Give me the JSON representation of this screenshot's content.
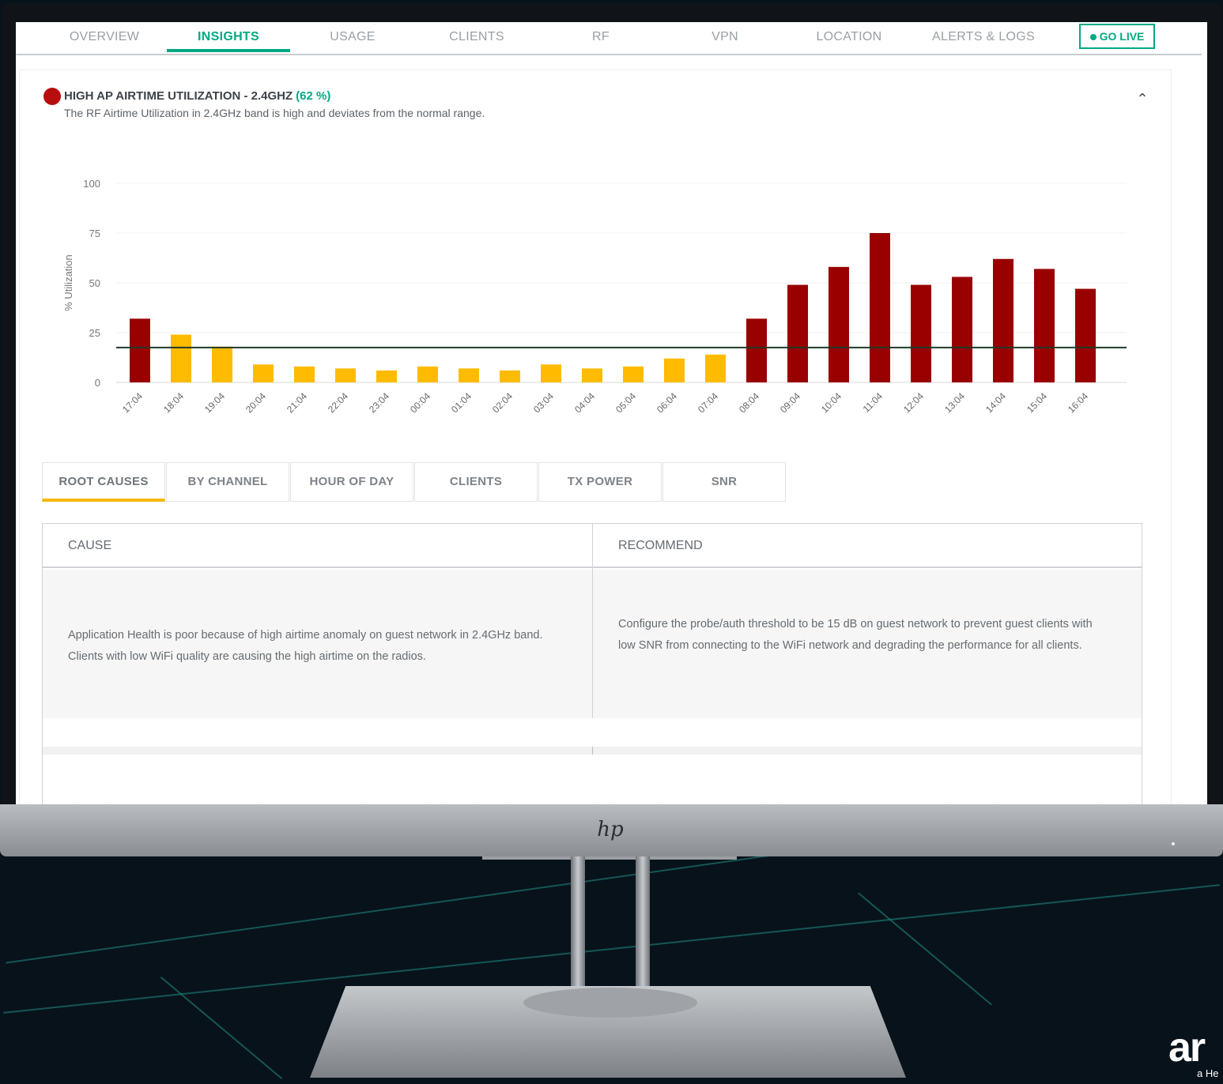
{
  "nav": {
    "tabs": [
      "OVERVIEW",
      "INSIGHTS",
      "USAGE",
      "CLIENTS",
      "RF",
      "VPN",
      "LOCATION",
      "ALERTS & LOGS"
    ],
    "active_tab": "INSIGHTS",
    "go_live": "GO LIVE"
  },
  "insight": {
    "title": "HIGH AP AIRTIME UTILIZATION - 2.4GHZ",
    "percent": "(62 %)",
    "description": "The RF Airtime Utilization in 2.4GHz band is high and deviates from the normal range.",
    "collapse_icon": "chevron-up-icon",
    "severity_color": "#b80d0d"
  },
  "chart_data": {
    "type": "bar",
    "ylabel": "% Utilization",
    "ylim": [
      0,
      100
    ],
    "yticks": [
      0,
      25,
      50,
      75,
      100
    ],
    "categories": [
      "17:04",
      "18:04",
      "19:04",
      "20:04",
      "21:04",
      "22:04",
      "23:04",
      "00:04",
      "01:04",
      "02:04",
      "03:04",
      "04:04",
      "05:04",
      "06:04",
      "07:04",
      "08:04",
      "09:04",
      "10:04",
      "11:04",
      "12:04",
      "13:04",
      "14:04",
      "15:04",
      "16:04"
    ],
    "values": [
      32,
      24,
      18,
      9,
      8,
      7,
      6,
      8,
      7,
      6,
      9,
      7,
      8,
      12,
      14,
      32,
      49,
      58,
      75,
      49,
      53,
      62,
      57,
      47
    ],
    "high_flags": [
      true,
      false,
      false,
      false,
      false,
      false,
      false,
      false,
      false,
      false,
      false,
      false,
      false,
      false,
      false,
      true,
      true,
      true,
      true,
      true,
      true,
      true,
      true,
      true
    ],
    "threshold": 17.5,
    "colors": {
      "high": "#990000",
      "normal": "#ffbb00",
      "threshold": "#1f3a2a",
      "grid": "#f0f0f0"
    },
    "grid": true
  },
  "subtabs": {
    "items": [
      "ROOT CAUSES",
      "BY CHANNEL",
      "HOUR OF DAY",
      "CLIENTS",
      "TX POWER",
      "SNR"
    ],
    "active": "ROOT CAUSES"
  },
  "table": {
    "headers": [
      "CAUSE",
      "RECOMMEND"
    ],
    "rows": [
      {
        "cause": "Application Health is poor because of high airtime anomaly on guest network in 2.4GHz band. Clients with low WiFi quality are causing the high airtime on the radios.",
        "recommend": "Configure the probe/auth threshold to be 15 dB on guest network to prevent guest clients with low SNR from connecting to the WiFi network and degrading the performance for all clients."
      }
    ]
  },
  "brand": {
    "mark": "ar",
    "sub": "a He"
  }
}
